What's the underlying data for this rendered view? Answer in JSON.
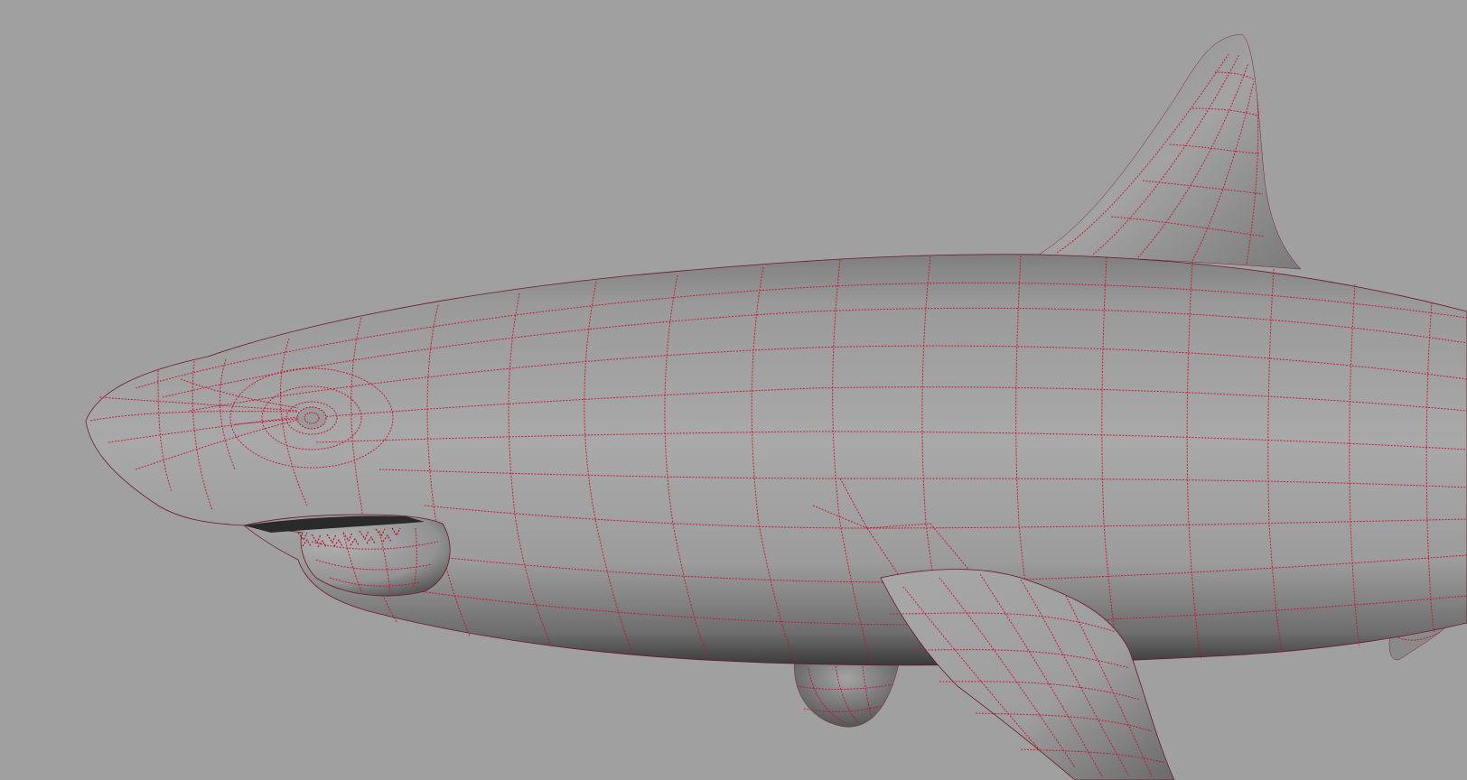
{
  "viewport": {
    "background_color": "#a0a0a0",
    "wireframe_color": "#c8102e",
    "shading": "smooth-shaded-with-wireframe",
    "model": "shark"
  }
}
